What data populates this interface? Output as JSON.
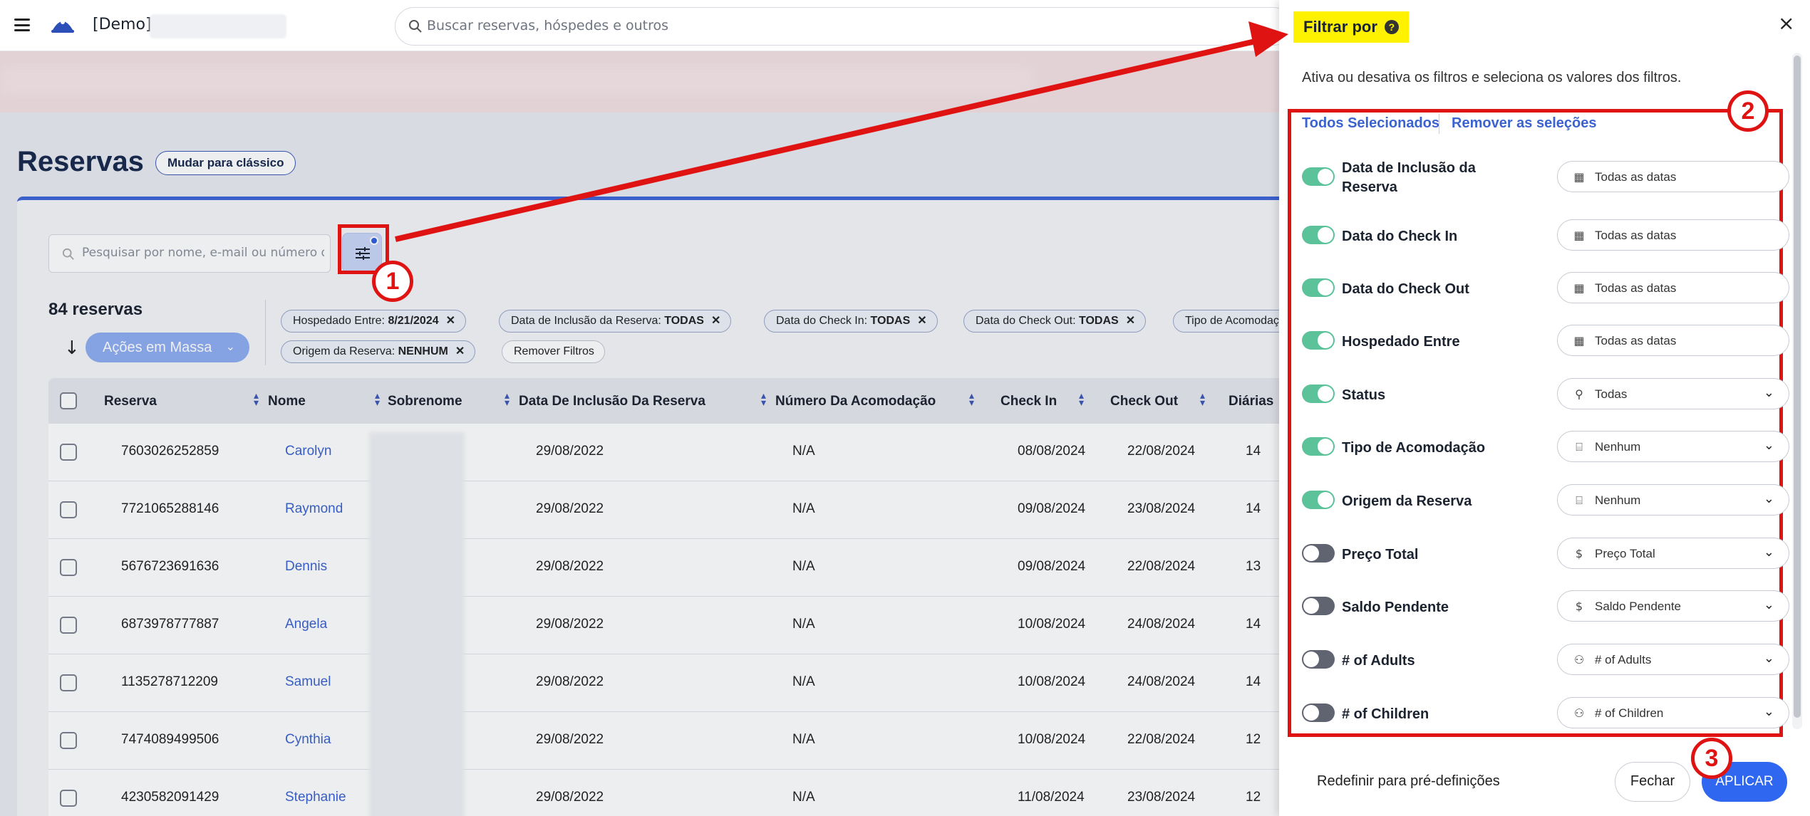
{
  "header": {
    "demo_label": "[Demo]",
    "search_placeholder": "Buscar reservas, hóspedes e outros"
  },
  "page": {
    "title": "Reservas",
    "classic_button": "Mudar para clássico"
  },
  "toolbar": {
    "search_placeholder": "Pesquisar por nome, e-mail ou número de reserva",
    "count": "84 reservas",
    "bulk_actions": "Ações em Massa"
  },
  "chips": [
    {
      "label": "Hospedado Entre:",
      "value": "8/21/2024"
    },
    {
      "label": "Data de Inclusão da Reserva:",
      "value": "TODAS"
    },
    {
      "label": "Data do Check In:",
      "value": "TODAS"
    },
    {
      "label": "Data do Check Out:",
      "value": "TODAS"
    },
    {
      "label": "Tipo de Acomodação",
      "value": ""
    },
    {
      "label": "Origem da Reserva:",
      "value": "NENHUM"
    }
  ],
  "remove_filters": "Remover Filtros",
  "table": {
    "columns": [
      "Reserva",
      "Nome",
      "Sobrenome",
      "Data De Inclusão Da Reserva",
      "Número Da Acomodação",
      "Check In",
      "Check Out",
      "Diárias"
    ],
    "rows": [
      {
        "reserva": "7603026252859",
        "nome": "Carolyn",
        "inclusao": "29/08/2022",
        "acomodacao": "N/A",
        "checkin": "08/08/2024",
        "checkout": "22/08/2024",
        "diarias": "14"
      },
      {
        "reserva": "7721065288146",
        "nome": "Raymond",
        "inclusao": "29/08/2022",
        "acomodacao": "N/A",
        "checkin": "09/08/2024",
        "checkout": "23/08/2024",
        "diarias": "14"
      },
      {
        "reserva": "5676723691636",
        "nome": "Dennis",
        "inclusao": "29/08/2022",
        "acomodacao": "N/A",
        "checkin": "09/08/2024",
        "checkout": "22/08/2024",
        "diarias": "13"
      },
      {
        "reserva": "6873978777887",
        "nome": "Angela",
        "inclusao": "29/08/2022",
        "acomodacao": "N/A",
        "checkin": "10/08/2024",
        "checkout": "24/08/2024",
        "diarias": "14"
      },
      {
        "reserva": "1135278712209",
        "nome": "Samuel",
        "inclusao": "29/08/2022",
        "acomodacao": "N/A",
        "checkin": "10/08/2024",
        "checkout": "24/08/2024",
        "diarias": "14"
      },
      {
        "reserva": "7474089499506",
        "nome": "Cynthia",
        "inclusao": "29/08/2022",
        "acomodacao": "N/A",
        "checkin": "10/08/2024",
        "checkout": "22/08/2024",
        "diarias": "12"
      },
      {
        "reserva": "4230582091429",
        "nome": "Stephanie",
        "inclusao": "29/08/2022",
        "acomodacao": "N/A",
        "checkin": "11/08/2024",
        "checkout": "23/08/2024",
        "diarias": "12"
      }
    ]
  },
  "panel": {
    "title": "Filtrar por",
    "help_icon": "?",
    "close_icon": "×",
    "description": "Ativa ou desativa os filtros e seleciona os valores dos filtros.",
    "select_all": "Todos Selecionados",
    "remove_selections": "Remover as seleções",
    "filters": [
      {
        "label": "Data de Inclusão da Reserva",
        "on": true,
        "icon": "calendar-icon",
        "value": "Todas as datas",
        "dropdown": false
      },
      {
        "label": "Data do Check In",
        "on": true,
        "icon": "calendar-icon",
        "value": "Todas as datas",
        "dropdown": false
      },
      {
        "label": "Data do Check Out",
        "on": true,
        "icon": "calendar-icon",
        "value": "Todas as datas",
        "dropdown": false
      },
      {
        "label": "Hospedado Entre",
        "on": true,
        "icon": "calendar-icon",
        "value": "Todas as datas",
        "dropdown": false
      },
      {
        "label": "Status",
        "on": true,
        "icon": "person-icon",
        "value": "Todas",
        "dropdown": true
      },
      {
        "label": "Tipo de Acomodação",
        "on": true,
        "icon": "bed-icon",
        "value": "Nenhum",
        "dropdown": true
      },
      {
        "label": "Origem da Reserva",
        "on": true,
        "icon": "bed-icon",
        "value": "Nenhum",
        "dropdown": true
      },
      {
        "label": "Preço Total",
        "on": false,
        "icon": "dollar-icon",
        "value": "Preço Total",
        "dropdown": true
      },
      {
        "label": "Saldo Pendente",
        "on": false,
        "icon": "dollar-icon",
        "value": "Saldo Pendente",
        "dropdown": true
      },
      {
        "label": "# of Adults",
        "on": false,
        "icon": "group-icon",
        "value": "# of Adults",
        "dropdown": true
      },
      {
        "label": "# of Children",
        "on": false,
        "icon": "group-icon",
        "value": "# of Children",
        "dropdown": true
      }
    ],
    "reset": "Redefinir para pré-definições",
    "close_button": "Fechar",
    "apply_button": "APLICAR"
  },
  "annotations": {
    "step1": "1",
    "step2": "2",
    "step3": "3",
    "color": "#e01313"
  }
}
